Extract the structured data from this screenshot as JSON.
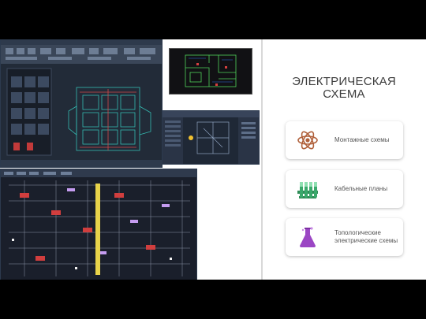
{
  "slide": {
    "title": "ЭЛЕКТРИЧЕСКАЯ СХЕМА",
    "background": "#ffffff",
    "frame_color": "#000000"
  },
  "screenshots": [
    {
      "name": "cad-floorplan-window"
    },
    {
      "name": "cad-plan-preview"
    },
    {
      "name": "cad-3d-window"
    },
    {
      "name": "cad-schematic-window"
    }
  ],
  "cards": [
    {
      "label": "Монтажные схемы",
      "icon": "atom-icon",
      "icon_color": "#b0603a"
    },
    {
      "label": "Кабельные планы",
      "icon": "test-tubes-icon",
      "icon_color": "#3aa86b"
    },
    {
      "label": "Топологические электрические схемы",
      "icon": "flask-icon",
      "icon_color": "#9b46c4"
    }
  ]
}
